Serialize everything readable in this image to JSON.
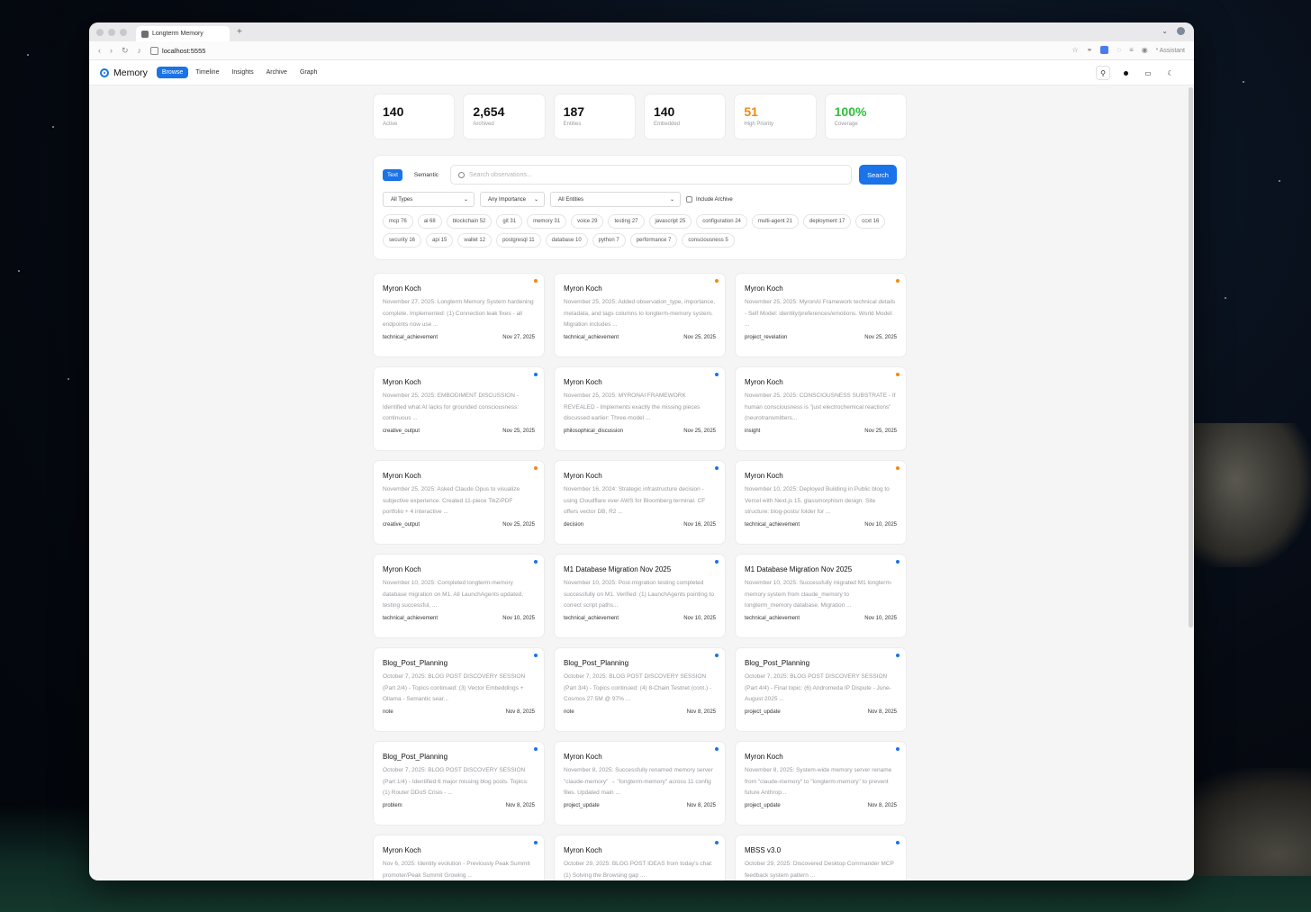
{
  "browser": {
    "tab_title": "Longterm Memory",
    "new_tab": "+",
    "url": "localhost:5555",
    "assistant_label": "Assistant"
  },
  "app": {
    "brand": "Memory",
    "nav": [
      "Browse",
      "Timeline",
      "Insights",
      "Archive",
      "Graph"
    ],
    "active_nav": "Browse"
  },
  "stats": [
    {
      "value": "140",
      "label": "Active",
      "color": "#111111"
    },
    {
      "value": "2,654",
      "label": "Archived",
      "color": "#111111"
    },
    {
      "value": "187",
      "label": "Entities",
      "color": "#111111"
    },
    {
      "value": "140",
      "label": "Embedded",
      "color": "#111111"
    },
    {
      "value": "51",
      "label": "High Priority",
      "color": "#f08a12"
    },
    {
      "value": "100%",
      "label": "Coverage",
      "color": "#2fbf3a"
    }
  ],
  "search": {
    "modes": [
      "Text",
      "Semantic"
    ],
    "active_mode": "Text",
    "placeholder": "Search observations...",
    "button": "Search",
    "filters": {
      "type": "All Types",
      "importance": "Any Importance",
      "entities": "All Entities",
      "include_archive": "Include Archive"
    },
    "chips": [
      "mcp 76",
      "ai 68",
      "blockchain 52",
      "git 31",
      "memory 31",
      "voice 29",
      "testing 27",
      "javascript 25",
      "configuration 24",
      "multi-agent 21",
      "deployment 17",
      "ccxt 16",
      "security 16",
      "api 15",
      "wallet 12",
      "postgresql 11",
      "database 10",
      "python 7",
      "performance 7",
      "consciousness 5"
    ]
  },
  "colors": {
    "accent": "#1a73e8",
    "high": "#f08a12",
    "normal": "#1a73e8"
  },
  "cards": [
    {
      "title": "Myron Koch",
      "body": "November 27, 2025: Longterm Memory System hardening complete. Implemented: (1) Connection leak fixes - all endpoints now use ...",
      "type": "technical_achievement",
      "date": "Nov 27, 2025",
      "dot": "#f08a12"
    },
    {
      "title": "Myron Koch",
      "body": "November 25, 2025: Added observation_type, importance, metadata, and tags columns to longterm-memory system. Migration includes ...",
      "type": "technical_achievement",
      "date": "Nov 25, 2025",
      "dot": "#f08a12"
    },
    {
      "title": "Myron Koch",
      "body": "November 25, 2025: MyronAI Framework technical details - Self Model: identity/preferences/emotions. World Model: ...",
      "type": "project_revelation",
      "date": "Nov 25, 2025",
      "dot": "#f08a12"
    },
    {
      "title": "Myron Koch",
      "body": "November 25, 2025: EMBODIMENT DISCUSSION - Identified what AI lacks for grounded consciousness: continuous ...",
      "type": "creative_output",
      "date": "Nov 25, 2025",
      "dot": "#1a73e8"
    },
    {
      "title": "Myron Koch",
      "body": "November 25, 2025: MYRONAI FRAMEWORK REVEALED - Implements exactly the missing pieces discussed earlier: Three-model ...",
      "type": "philosophical_discussion",
      "date": "Nov 25, 2025",
      "dot": "#1a73e8"
    },
    {
      "title": "Myron Koch",
      "body": "November 25, 2025: CONSCIOUSNESS SUBSTRATE - If human consciousness is \"just electrochemical reactions\" (neurotransmitters...",
      "type": "insight",
      "date": "Nov 25, 2025",
      "dot": "#f08a12"
    },
    {
      "title": "Myron Koch",
      "body": "November 25, 2025: Asked Claude Opus to visualize subjective experience. Created 11-piece TikZ/PDF portfolio + 4 interactive ...",
      "type": "creative_output",
      "date": "Nov 25, 2025",
      "dot": "#f08a12"
    },
    {
      "title": "Myron Koch",
      "body": "November 16, 2024: Strategic infrastructure decision - using Cloudflare over AWS for Bloomberg terminal. CF offers vector DB, R2 ...",
      "type": "decision",
      "date": "Nov 16, 2025",
      "dot": "#1a73e8"
    },
    {
      "title": "Myron Koch",
      "body": "November 10, 2025: Deployed Building in Public blog to Vercel with Next.js 15, glassmorphism design. Site structure: blog-posts/ folder for ...",
      "type": "technical_achievement",
      "date": "Nov 10, 2025",
      "dot": "#f08a12"
    },
    {
      "title": "Myron Koch",
      "body": "November 10, 2025: Completed longterm-memory database migration on M1. All LaunchAgents updated, testing successful, ...",
      "type": "technical_achievement",
      "date": "Nov 10, 2025",
      "dot": "#1a73e8"
    },
    {
      "title": "M1 Database Migration Nov 2025",
      "body": "November 10, 2025: Post-migration testing completed successfully on M1. Verified: (1) LaunchAgents pointing to correct script paths...",
      "type": "technical_achievement",
      "date": "Nov 10, 2025",
      "dot": "#1a73e8"
    },
    {
      "title": "M1 Database Migration Nov 2025",
      "body": "November 10, 2025: Successfully migrated M1 longterm-memory system from claude_memory to longterm_memory database. Migration ...",
      "type": "technical_achievement",
      "date": "Nov 10, 2025",
      "dot": "#1a73e8"
    },
    {
      "title": "Blog_Post_Planning",
      "body": "October 7, 2025: BLOG POST DISCOVERY SESSION (Part 2/4) - Topics continued: (3) Vector Embeddings + Ollama - Semantic sear...",
      "type": "note",
      "date": "Nov 8, 2025",
      "dot": "#1a73e8"
    },
    {
      "title": "Blog_Post_Planning",
      "body": "October 7, 2025: BLOG POST DISCOVERY SESSION (Part 3/4) - Topics continued: (4) 8-Chain Testnet (cont.) - Cosmos 27.5M @ 97% ...",
      "type": "note",
      "date": "Nov 8, 2025",
      "dot": "#1a73e8"
    },
    {
      "title": "Blog_Post_Planning",
      "body": "October 7, 2025: BLOG POST DISCOVERY SESSION (Part 4/4) - Final topic: (6) Andromeda IP Dispute - June-August 2025 ...",
      "type": "project_update",
      "date": "Nov 8, 2025",
      "dot": "#1a73e8"
    },
    {
      "title": "Blog_Post_Planning",
      "body": "October 7, 2025: BLOG POST DISCOVERY SESSION (Part 1/4) - Identified 6 major missing blog posts. Topics: (1) Router DDoS Crisis - ...",
      "type": "problem",
      "date": "Nov 8, 2025",
      "dot": "#1a73e8"
    },
    {
      "title": "Myron Koch",
      "body": "November 8, 2025: Successfully renamed memory server \"claude-memory\" → \"longterm-memory\" across 11 config files. Updated main ...",
      "type": "project_update",
      "date": "Nov 8, 2025",
      "dot": "#1a73e8"
    },
    {
      "title": "Myron Koch",
      "body": "November 8, 2025: System-wide memory server rename from \"claude-memory\" to \"longterm-memory\" to prevent future Anthrop...",
      "type": "project_update",
      "date": "Nov 8, 2025",
      "dot": "#1a73e8"
    },
    {
      "title": "Myron Koch",
      "body": "Nov 6, 2025: Identity evolution - Previously Peak Summit promoter/Peak Summit Growing ...",
      "type": "",
      "date": "",
      "dot": "#1a73e8"
    },
    {
      "title": "Myron Koch",
      "body": "October 29, 2025: BLOG POST IDEAS from today's chat: (1) Solving the Browsing gap ...",
      "type": "",
      "date": "",
      "dot": "#1a73e8"
    },
    {
      "title": "MBSS v3.0",
      "body": "October 29, 2025: Discovered Desktop Commander MCP feedback system pattern ...",
      "type": "",
      "date": "",
      "dot": "#1a73e8"
    }
  ]
}
